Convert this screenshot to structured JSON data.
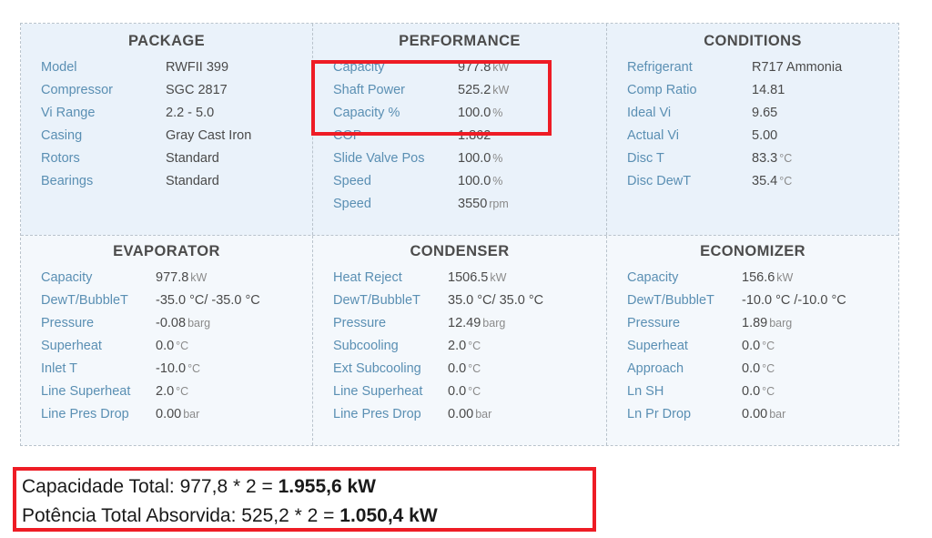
{
  "table": {
    "top_band": [
      {
        "title": "PACKAGE",
        "rows": [
          {
            "label": "Model",
            "value": "RWFII 399",
            "unit": ""
          },
          {
            "label": "Compressor",
            "value": "SGC 2817",
            "unit": ""
          },
          {
            "label": "Vi Range",
            "value": "2.2 - 5.0",
            "unit": ""
          },
          {
            "label": "Casing",
            "value": "Gray Cast Iron",
            "unit": ""
          },
          {
            "label": "Rotors",
            "value": "Standard",
            "unit": ""
          },
          {
            "label": "Bearings",
            "value": "Standard",
            "unit": ""
          }
        ]
      },
      {
        "title": "PERFORMANCE",
        "rows": [
          {
            "label": "Capacity",
            "value": "977.8",
            "unit": "kW"
          },
          {
            "label": "Shaft Power",
            "value": "525.2",
            "unit": "kW"
          },
          {
            "label": "Capacity %",
            "value": "100.0",
            "unit": "%"
          },
          {
            "label": "COP",
            "value": "1.862",
            "unit": ""
          },
          {
            "label": "Slide Valve Pos",
            "value": "100.0",
            "unit": "%"
          },
          {
            "label": "Speed",
            "value": "100.0",
            "unit": "%"
          },
          {
            "label": "Speed",
            "value": "3550",
            "unit": "rpm"
          }
        ]
      },
      {
        "title": "CONDITIONS",
        "rows": [
          {
            "label": "Refrigerant",
            "value": "R717 Ammonia",
            "unit": ""
          },
          {
            "label": "Comp Ratio",
            "value": "14.81",
            "unit": ""
          },
          {
            "label": "Ideal Vi",
            "value": "9.65",
            "unit": ""
          },
          {
            "label": "Actual Vi",
            "value": "5.00",
            "unit": ""
          },
          {
            "label": "Disc T",
            "value": "83.3",
            "unit": "°C"
          },
          {
            "label": "Disc DewT",
            "value": "35.4",
            "unit": "°C"
          }
        ]
      }
    ],
    "bottom_band": [
      {
        "title": "EVAPORATOR",
        "rows": [
          {
            "label": "Capacity",
            "value": "977.8",
            "unit": "kW"
          },
          {
            "label": "DewT/BubbleT",
            "value": "-35.0 °C/ -35.0 °C",
            "unit": ""
          },
          {
            "label": "Pressure",
            "value": "-0.08",
            "unit": "barg"
          },
          {
            "label": "Superheat",
            "value": "0.0",
            "unit": "°C"
          },
          {
            "label": "Inlet T",
            "value": "-10.0",
            "unit": "°C"
          },
          {
            "label": "Line Superheat",
            "value": "2.0",
            "unit": "°C"
          },
          {
            "label": "Line Pres Drop",
            "value": "0.00",
            "unit": "bar"
          }
        ]
      },
      {
        "title": "CONDENSER",
        "rows": [
          {
            "label": "Heat Reject",
            "value": "1506.5",
            "unit": "kW"
          },
          {
            "label": "DewT/BubbleT",
            "value": "35.0 °C/ 35.0 °C",
            "unit": ""
          },
          {
            "label": "Pressure",
            "value": "12.49",
            "unit": "barg"
          },
          {
            "label": "Subcooling",
            "value": "2.0",
            "unit": "°C"
          },
          {
            "label": "Ext Subcooling",
            "value": "0.0",
            "unit": "°C"
          },
          {
            "label": "Line Superheat",
            "value": "0.0",
            "unit": "°C"
          },
          {
            "label": "Line Pres Drop",
            "value": "0.00",
            "unit": "bar"
          }
        ]
      },
      {
        "title": "ECONOMIZER",
        "rows": [
          {
            "label": "Capacity",
            "value": "156.6",
            "unit": "kW"
          },
          {
            "label": "DewT/BubbleT",
            "value": "-10.0 °C /-10.0 °C",
            "unit": ""
          },
          {
            "label": "Pressure",
            "value": "1.89",
            "unit": "barg"
          },
          {
            "label": "Superheat",
            "value": "0.0",
            "unit": "°C"
          },
          {
            "label": "Approach",
            "value": "0.0",
            "unit": "°C"
          },
          {
            "label": "Ln SH",
            "value": "0.0",
            "unit": "°C"
          },
          {
            "label": "Ln Pr Drop",
            "value": "0.00",
            "unit": "bar"
          }
        ]
      }
    ]
  },
  "summary": {
    "lines": [
      {
        "prefix": "Capacidade Total: 977,8 * 2 = ",
        "bold": "1.955,6 kW"
      },
      {
        "prefix": "Potência Total Absorvida: 525,2 * 2 = ",
        "bold": "1.050,4 kW"
      }
    ]
  },
  "colors": {
    "highlight": "#ee1c25",
    "label": "#5a8fb3",
    "value": "#4a4a4a",
    "title": "#4c4c4c",
    "band_top_bg": "#eaf2fa",
    "band_bottom_bg": "#f4f8fc"
  }
}
